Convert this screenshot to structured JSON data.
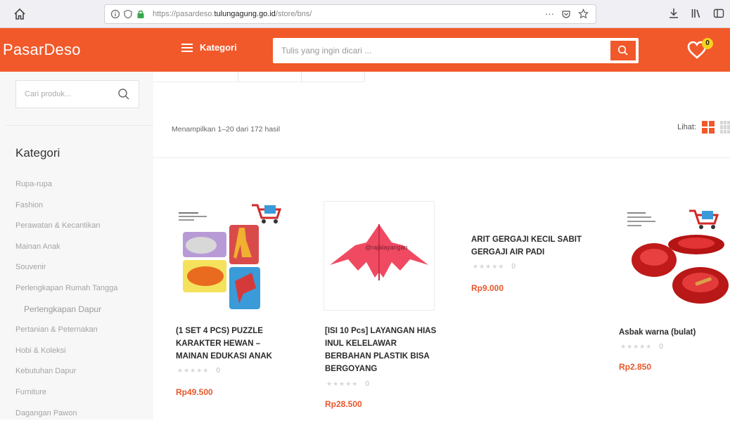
{
  "browser": {
    "url_prefix": "https://pasardeso.",
    "url_domain": "tulungagung.go.id",
    "url_suffix": "/store/bns/",
    "more_label": "···"
  },
  "header": {
    "logo": "PasarDeso",
    "kategori_label": "Kategori",
    "search_placeholder": "Tulis yang ingin dicari ...",
    "wishlist_count": "0"
  },
  "sidebar": {
    "search_placeholder": "Cari produk...",
    "title": "Kategori",
    "categories": [
      {
        "label": "Rupa-rupa",
        "sub": false
      },
      {
        "label": "Fashion",
        "sub": false
      },
      {
        "label": "Perawatan & Kecantikan",
        "sub": false
      },
      {
        "label": "Mainan Anak",
        "sub": false
      },
      {
        "label": "Souvenir",
        "sub": false
      },
      {
        "label": "Perlengkapan Rumah Tangga",
        "sub": false
      },
      {
        "label": "Perlengkapan Dapur",
        "sub": true
      },
      {
        "label": "Pertanian & Peternakan",
        "sub": false
      },
      {
        "label": "Hobi & Koleksi",
        "sub": false
      },
      {
        "label": "Kebutuhan Dapur",
        "sub": false
      },
      {
        "label": "Furniture",
        "sub": false
      },
      {
        "label": "Dagangan Pawon",
        "sub": false
      }
    ]
  },
  "results": {
    "count_text": "Menampilkan 1–20 dari 172 hasil",
    "view_label": "Lihat:"
  },
  "products": [
    {
      "name": "(1 SET 4 PCS) PUZZLE KARAKTER HEWAN – MAINAN EDUKASI ANAK",
      "stars": "★★★★★",
      "reviews": "0",
      "price": "Rp49.500",
      "image": "puzzle"
    },
    {
      "name": "[ISI 10 Pcs] LAYANGAN HIAS INUL KELELAWAR BERBAHAN PLASTIK BISA BERGOYANG",
      "stars": "★★★★★",
      "reviews": "0",
      "price": "Rp28.500",
      "image": "kite",
      "watermark": "@rajalayangan"
    },
    {
      "name": "ARIT GERGAJI KECIL SABIT GERGAJI AIR PADI",
      "stars": "★★★★★",
      "reviews": "0",
      "price": "Rp9.000",
      "image": "none"
    },
    {
      "name": "Asbak warna (bulat)",
      "stars": "★★★★★",
      "reviews": "0",
      "price": "Rp2.850",
      "image": "ashtray"
    }
  ],
  "colors": {
    "brand": "#f1592a",
    "price": "#e8572b",
    "badge": "#f6d21c"
  }
}
